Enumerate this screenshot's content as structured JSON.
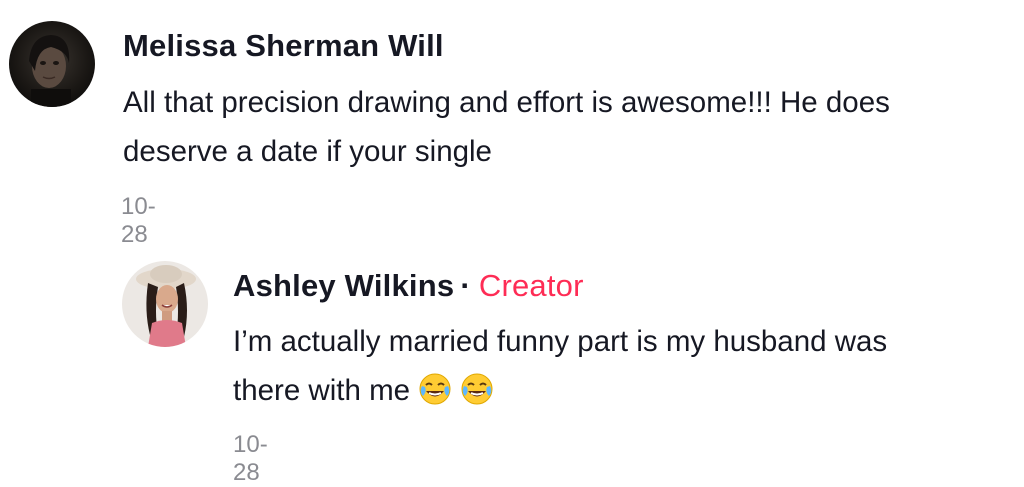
{
  "comments": [
    {
      "author": "Melissa Sherman Will",
      "text_line1": "All that precision drawing and effort is awesome!!! He does",
      "text_line2": "deserve a date if your single",
      "date": "10-28"
    }
  ],
  "reply": {
    "author": "Ashley Wilkins",
    "separator": "·",
    "badge": "Creator",
    "text_line1": "I’m actually married funny part is my husband was",
    "text_line2": "there with me",
    "emojis": [
      "face-with-tears-of-joy-icon",
      "face-with-tears-of-joy-icon"
    ],
    "date": "10-28"
  },
  "colors": {
    "text": "#161823",
    "secondary": "#8a8b91",
    "creator_badge": "#fe2c55"
  }
}
